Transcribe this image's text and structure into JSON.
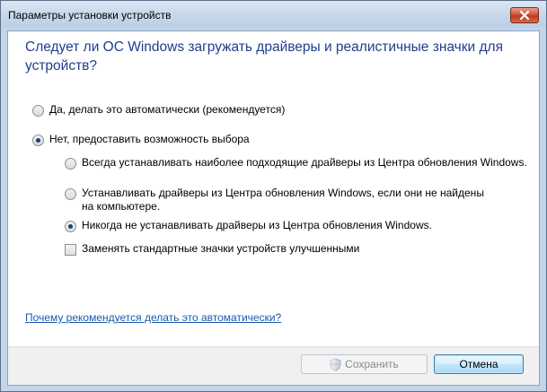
{
  "window": {
    "title": "Параметры установки устройств",
    "close_icon": "close-icon"
  },
  "dialog": {
    "heading": "Следует ли ОС Windows загружать драйверы и реалистичные значки для устройств?",
    "options": {
      "auto": {
        "label": "Да, делать это автоматически (рекомендуется)",
        "checked": false
      },
      "choose": {
        "label": "Нет, предоставить возможность выбора",
        "checked": true
      }
    },
    "sub_options": {
      "always": {
        "label": "Всегда устанавливать наиболее подходящие драйверы из Центра обновления Windows.",
        "checked": false
      },
      "if_missing": {
        "label": "Устанавливать драйверы из Центра обновления Windows, если они не найдены на компьютере.",
        "checked": false
      },
      "never": {
        "label": "Никогда не устанавливать драйверы из Центра обновления Windows.",
        "checked": true
      }
    },
    "replace_icons": {
      "label": "Заменять стандартные значки устройств улучшенными",
      "checked": false
    },
    "help_link": "Почему рекомендуется делать это автоматически?"
  },
  "buttons": {
    "save": {
      "label": "Сохранить",
      "enabled": false,
      "icon": "shield-icon"
    },
    "cancel": {
      "label": "Отмена",
      "enabled": true
    }
  },
  "colors": {
    "heading": "#1f3e8c",
    "link": "#1a5bb0",
    "close_button": "#c8472c"
  }
}
